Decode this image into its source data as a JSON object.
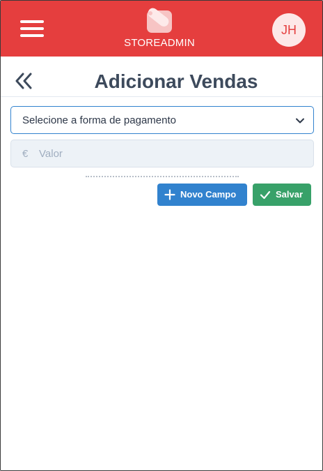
{
  "header": {
    "brand_name": "STOREADMIN",
    "avatar_initials": "JH",
    "menu_icon": "hamburger-menu-icon",
    "logo_icon": "store-tag-logo"
  },
  "page": {
    "title": "Adicionar Vendas",
    "back_icon": "double-chevron-left-icon"
  },
  "form": {
    "payment_select": {
      "selected": "Selecione a forma de pagamento",
      "icon": "chevron-down-icon"
    },
    "value_field": {
      "currency": "€",
      "placeholder": "Valor",
      "value": ""
    }
  },
  "actions": {
    "new_field_label": "Novo Campo",
    "new_field_icon": "plus-icon",
    "save_label": "Salvar",
    "save_icon": "check-icon"
  },
  "colors": {
    "brand_red": "#e53e3e",
    "primary_blue": "#3182ce",
    "success_green": "#38a169",
    "title_slate": "#3d4a5c"
  }
}
